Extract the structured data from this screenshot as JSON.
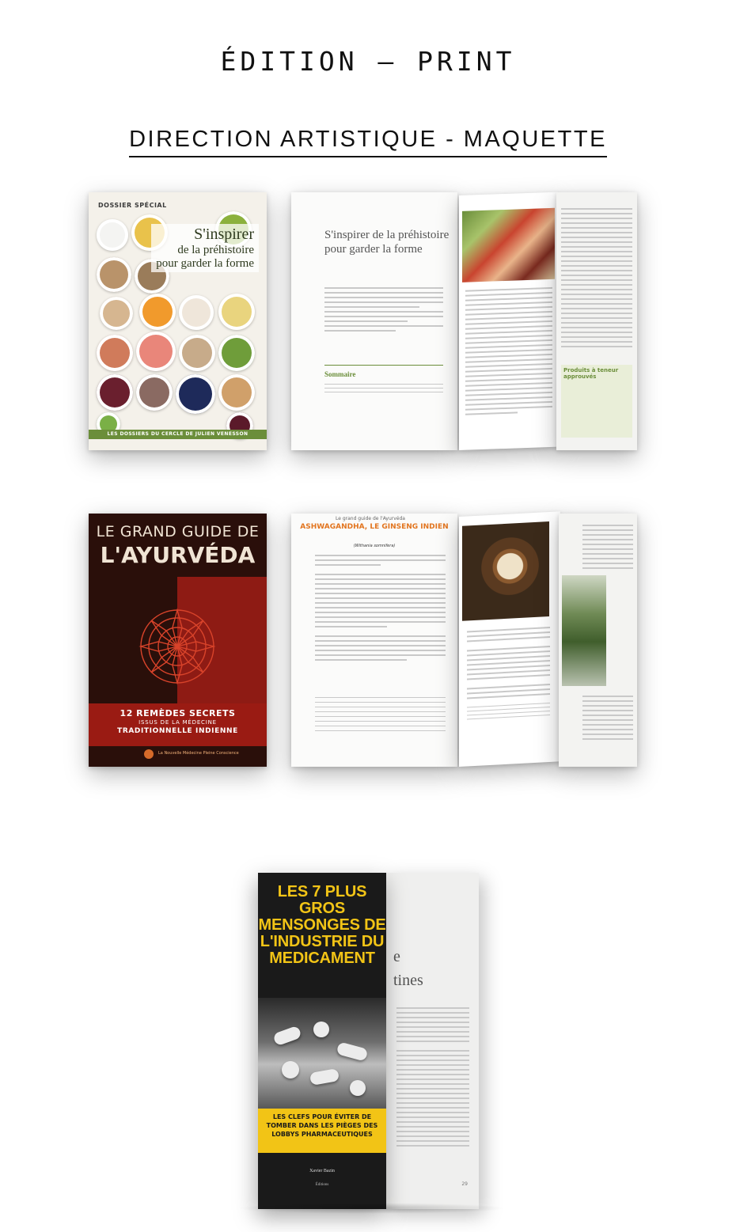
{
  "header": {
    "title": "ÉDITION – PRINT",
    "subtitle": "DIRECTION ARTISTIQUE - MAQUETTE"
  },
  "mockup1": {
    "cover_label": "DOSSIER SPÉCIAL",
    "cover_title_line1": "S'inspirer",
    "cover_title_line2": "de la préhistoire",
    "cover_title_line3": "pour garder la forme",
    "cover_band": "LES DOSSIERS DU CERCLE DE JULIEN VENESSON",
    "spread_heading": "S'inspirer de la préhistoire pour garder la forme",
    "spread_section": "Sommaire",
    "spread_box_title": "Produits à teneur approuvés"
  },
  "mockup2": {
    "cover_title_line1": "LE GRAND GUIDE DE",
    "cover_title_line2": "L'AYURVÉDA",
    "cover_band_line1": "12 REMÈDES SECRETS",
    "cover_band_line2": "ISSUS DE LA MÉDECINE",
    "cover_band_line3": "TRADITIONNELLE INDIENNE",
    "cover_logo_text": "La Nouvelle Médecine Pleine Conscience",
    "spread_running_head": "Le grand guide de l'Ayurvéda",
    "spread_heading": "ASHWAGANDHA, LE GINSENG INDIEN",
    "spread_subheading": "(Withania somnifera)"
  },
  "mockup3": {
    "cover_title": "LES 7 PLUS GROS MENSONGES DE L'INDUSTRIE DU MEDICAMENT",
    "cover_band": "LES CLEFS POUR ÉVITER DE TOMBER DANS LES PIÈGES DES LOBBYS PHARMACEUTIQUES",
    "cover_author": "Xavier Bazin",
    "cover_publisher": "Éditions",
    "inside_word1": "e",
    "inside_word2": "tines",
    "inside_page_number": "29"
  }
}
